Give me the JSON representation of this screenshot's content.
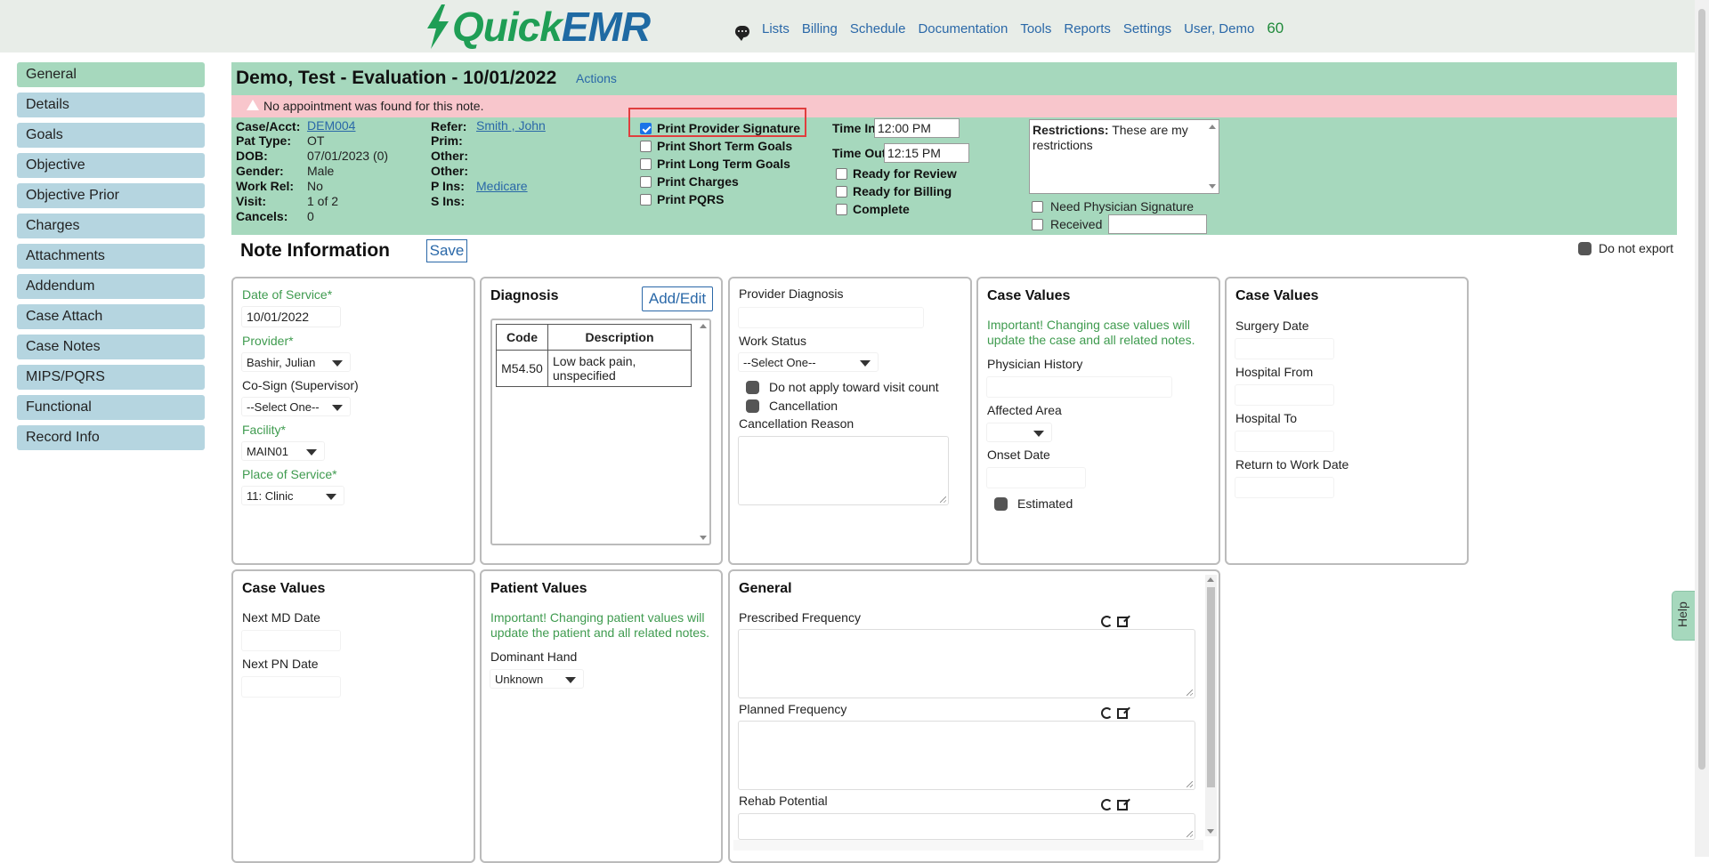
{
  "app": {
    "logo_quick": "Quick",
    "logo_emr": "EMR"
  },
  "nav": {
    "items": [
      "Lists",
      "Billing",
      "Schedule",
      "Documentation",
      "Tools",
      "Reports",
      "Settings",
      "User, Demo"
    ],
    "count": "60"
  },
  "sidebar": {
    "items": [
      {
        "label": "General",
        "active": true
      },
      {
        "label": "Details"
      },
      {
        "label": "Goals"
      },
      {
        "label": "Objective"
      },
      {
        "label": "Objective Prior"
      },
      {
        "label": "Charges"
      },
      {
        "label": "Attachments"
      },
      {
        "label": "Addendum"
      },
      {
        "label": "Case Attach"
      },
      {
        "label": "Case Notes"
      },
      {
        "label": "MIPS/PQRS"
      },
      {
        "label": "Functional"
      },
      {
        "label": "Record Info"
      }
    ]
  },
  "header": {
    "title": "Demo, Test - Evaluation - 10/01/2022",
    "actions": "Actions",
    "alert": "No appointment was found for this note.",
    "case_acct_label": "Case/Acct:",
    "case_acct": "DEM004",
    "pat_type_label": "Pat Type:",
    "pat_type": "OT",
    "dob_label": "DOB:",
    "dob": "07/01/2023 (0)",
    "gender_label": "Gender:",
    "gender": "Male",
    "work_rel_label": "Work Rel:",
    "work_rel": "No",
    "visit_label": "Visit:",
    "visit": "1 of 2",
    "cancels_label": "Cancels:",
    "cancels": "0",
    "refer_label": "Refer:",
    "refer": "Smith , John",
    "prim_label": "Prim:",
    "other1_label": "Other:",
    "other2_label": "Other:",
    "pins_label": "P Ins:",
    "pins": "Medicare",
    "sins_label": "S Ins:",
    "print_options": [
      {
        "label": "Print Provider Signature",
        "checked": true
      },
      {
        "label": "Print Short Term Goals"
      },
      {
        "label": "Print Long Term Goals"
      },
      {
        "label": "Print Charges"
      },
      {
        "label": "Print PQRS"
      }
    ],
    "time_in_label": "Time In",
    "time_in": "12:00 PM",
    "time_out_label": "Time Out",
    "time_out": "12:15 PM",
    "status_options": [
      "Ready for Review",
      "Ready for Billing",
      "Complete"
    ],
    "restrictions_label": "Restrictions:",
    "restrictions": "These are my restrictions",
    "need_sig": "Need Physician Signature",
    "received": "Received"
  },
  "note": {
    "title": "Note Information",
    "save": "Save",
    "do_not_export": "Do not export"
  },
  "panel1": {
    "dos_label": "Date of Service*",
    "dos": "10/01/2022",
    "provider_label": "Provider*",
    "provider": "Bashir, Julian",
    "cosign_label": "Co-Sign (Supervisor)",
    "cosign": "--Select One--",
    "facility_label": "Facility*",
    "facility": "MAIN01",
    "pos_label": "Place of Service*",
    "pos": "11: Clinic"
  },
  "diagnosis": {
    "title": "Diagnosis",
    "add_edit": "Add/Edit",
    "col_code": "Code",
    "col_desc": "Description",
    "rows": [
      {
        "code": "M54.50",
        "desc": "Low back pain, unspecified"
      }
    ]
  },
  "panel3": {
    "provider_diag": "Provider Diagnosis",
    "work_status": "Work Status",
    "work_status_val": "--Select One--",
    "no_visit": "Do not apply toward visit count",
    "cancellation": "Cancellation",
    "cancel_reason": "Cancellation Reason"
  },
  "case_values1": {
    "title": "Case Values",
    "warn": "Important! Changing case values will update the case and all related notes.",
    "phys_history": "Physician History",
    "affected_area": "Affected Area",
    "onset_date": "Onset Date",
    "estimated": "Estimated"
  },
  "case_values2": {
    "title": "Case Values",
    "surgery_date": "Surgery Date",
    "hospital_from": "Hospital From",
    "hospital_to": "Hospital To",
    "rtw": "Return to Work Date"
  },
  "case_values3": {
    "title": "Case Values",
    "next_md": "Next MD Date",
    "next_pn": "Next PN Date"
  },
  "patient_values": {
    "title": "Patient Values",
    "warn": "Important! Changing patient values will update the patient and all related notes.",
    "dom_hand": "Dominant Hand",
    "dom_hand_val": "Unknown"
  },
  "general": {
    "title": "General",
    "prescribed": "Prescribed Frequency",
    "planned": "Planned Frequency",
    "rehab": "Rehab Potential"
  },
  "help": "Help"
}
